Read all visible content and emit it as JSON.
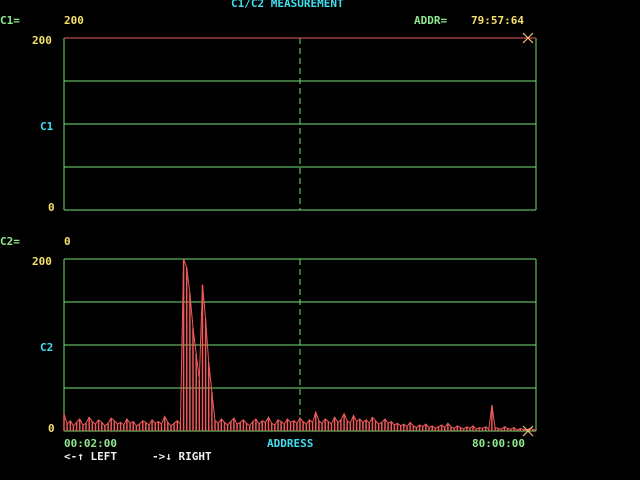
{
  "title": "C1/C2 MEASUREMENT",
  "c1": {
    "label": "C1=",
    "value": "200",
    "axis_max": "200",
    "axis_mid": "C1",
    "axis_min": "0"
  },
  "addr": {
    "label": "ADDR=",
    "value": "79:57:64"
  },
  "c2": {
    "label": "C2=",
    "value": "0",
    "axis_max": "200",
    "axis_mid": "C2",
    "axis_min": "0"
  },
  "x_axis": {
    "start": "00:02:00",
    "label": "ADDRESS",
    "end": "80:00:00"
  },
  "help": {
    "left": "<-↑ LEFT",
    "right": "->↓ RIGHT"
  },
  "colors": {
    "grid": "#74e074",
    "trace": "#f05a5a",
    "label": "#3ee0ef",
    "value": "#f4e06a",
    "marker": "#e8c070"
  },
  "icons": {
    "cursor_marker": "x-marker-icon"
  },
  "chart_data": [
    {
      "type": "line",
      "name": "C1",
      "ylim": [
        0,
        200
      ],
      "x_range": [
        "00:02:00",
        "80:00:00"
      ],
      "values": []
    },
    {
      "type": "line",
      "name": "C2",
      "ylim": [
        0,
        200
      ],
      "x_range": [
        "00:02:00",
        "80:00:00"
      ],
      "values": [
        20,
        8,
        12,
        6,
        10,
        14,
        7,
        9,
        16,
        11,
        8,
        13,
        10,
        6,
        9,
        15,
        12,
        8,
        10,
        7,
        14,
        9,
        11,
        6,
        8,
        12,
        10,
        7,
        13,
        9,
        11,
        8,
        17,
        10,
        6,
        9,
        12,
        8,
        200,
        190,
        160,
        120,
        90,
        60,
        170,
        130,
        80,
        45,
        12,
        9,
        14,
        10,
        7,
        11,
        15,
        8,
        10,
        13,
        9,
        6,
        11,
        14,
        8,
        12,
        10,
        16,
        9,
        7,
        13,
        11,
        8,
        14,
        10,
        12,
        9,
        15,
        11,
        8,
        13,
        10,
        22,
        12,
        9,
        14,
        11,
        8,
        16,
        10,
        13,
        20,
        12,
        9,
        18,
        11,
        14,
        10,
        13,
        9,
        16,
        12,
        8,
        10,
        14,
        9,
        11,
        7,
        9,
        6,
        8,
        5,
        10,
        6,
        4,
        7,
        5,
        8,
        4,
        6,
        3,
        5,
        7,
        4,
        9,
        5,
        3,
        6,
        4,
        2,
        5,
        3,
        6,
        2,
        4,
        3,
        5,
        2,
        30,
        4,
        3,
        2,
        5,
        3,
        2,
        4,
        1,
        3,
        2,
        1,
        3,
        2,
        1
      ]
    }
  ]
}
